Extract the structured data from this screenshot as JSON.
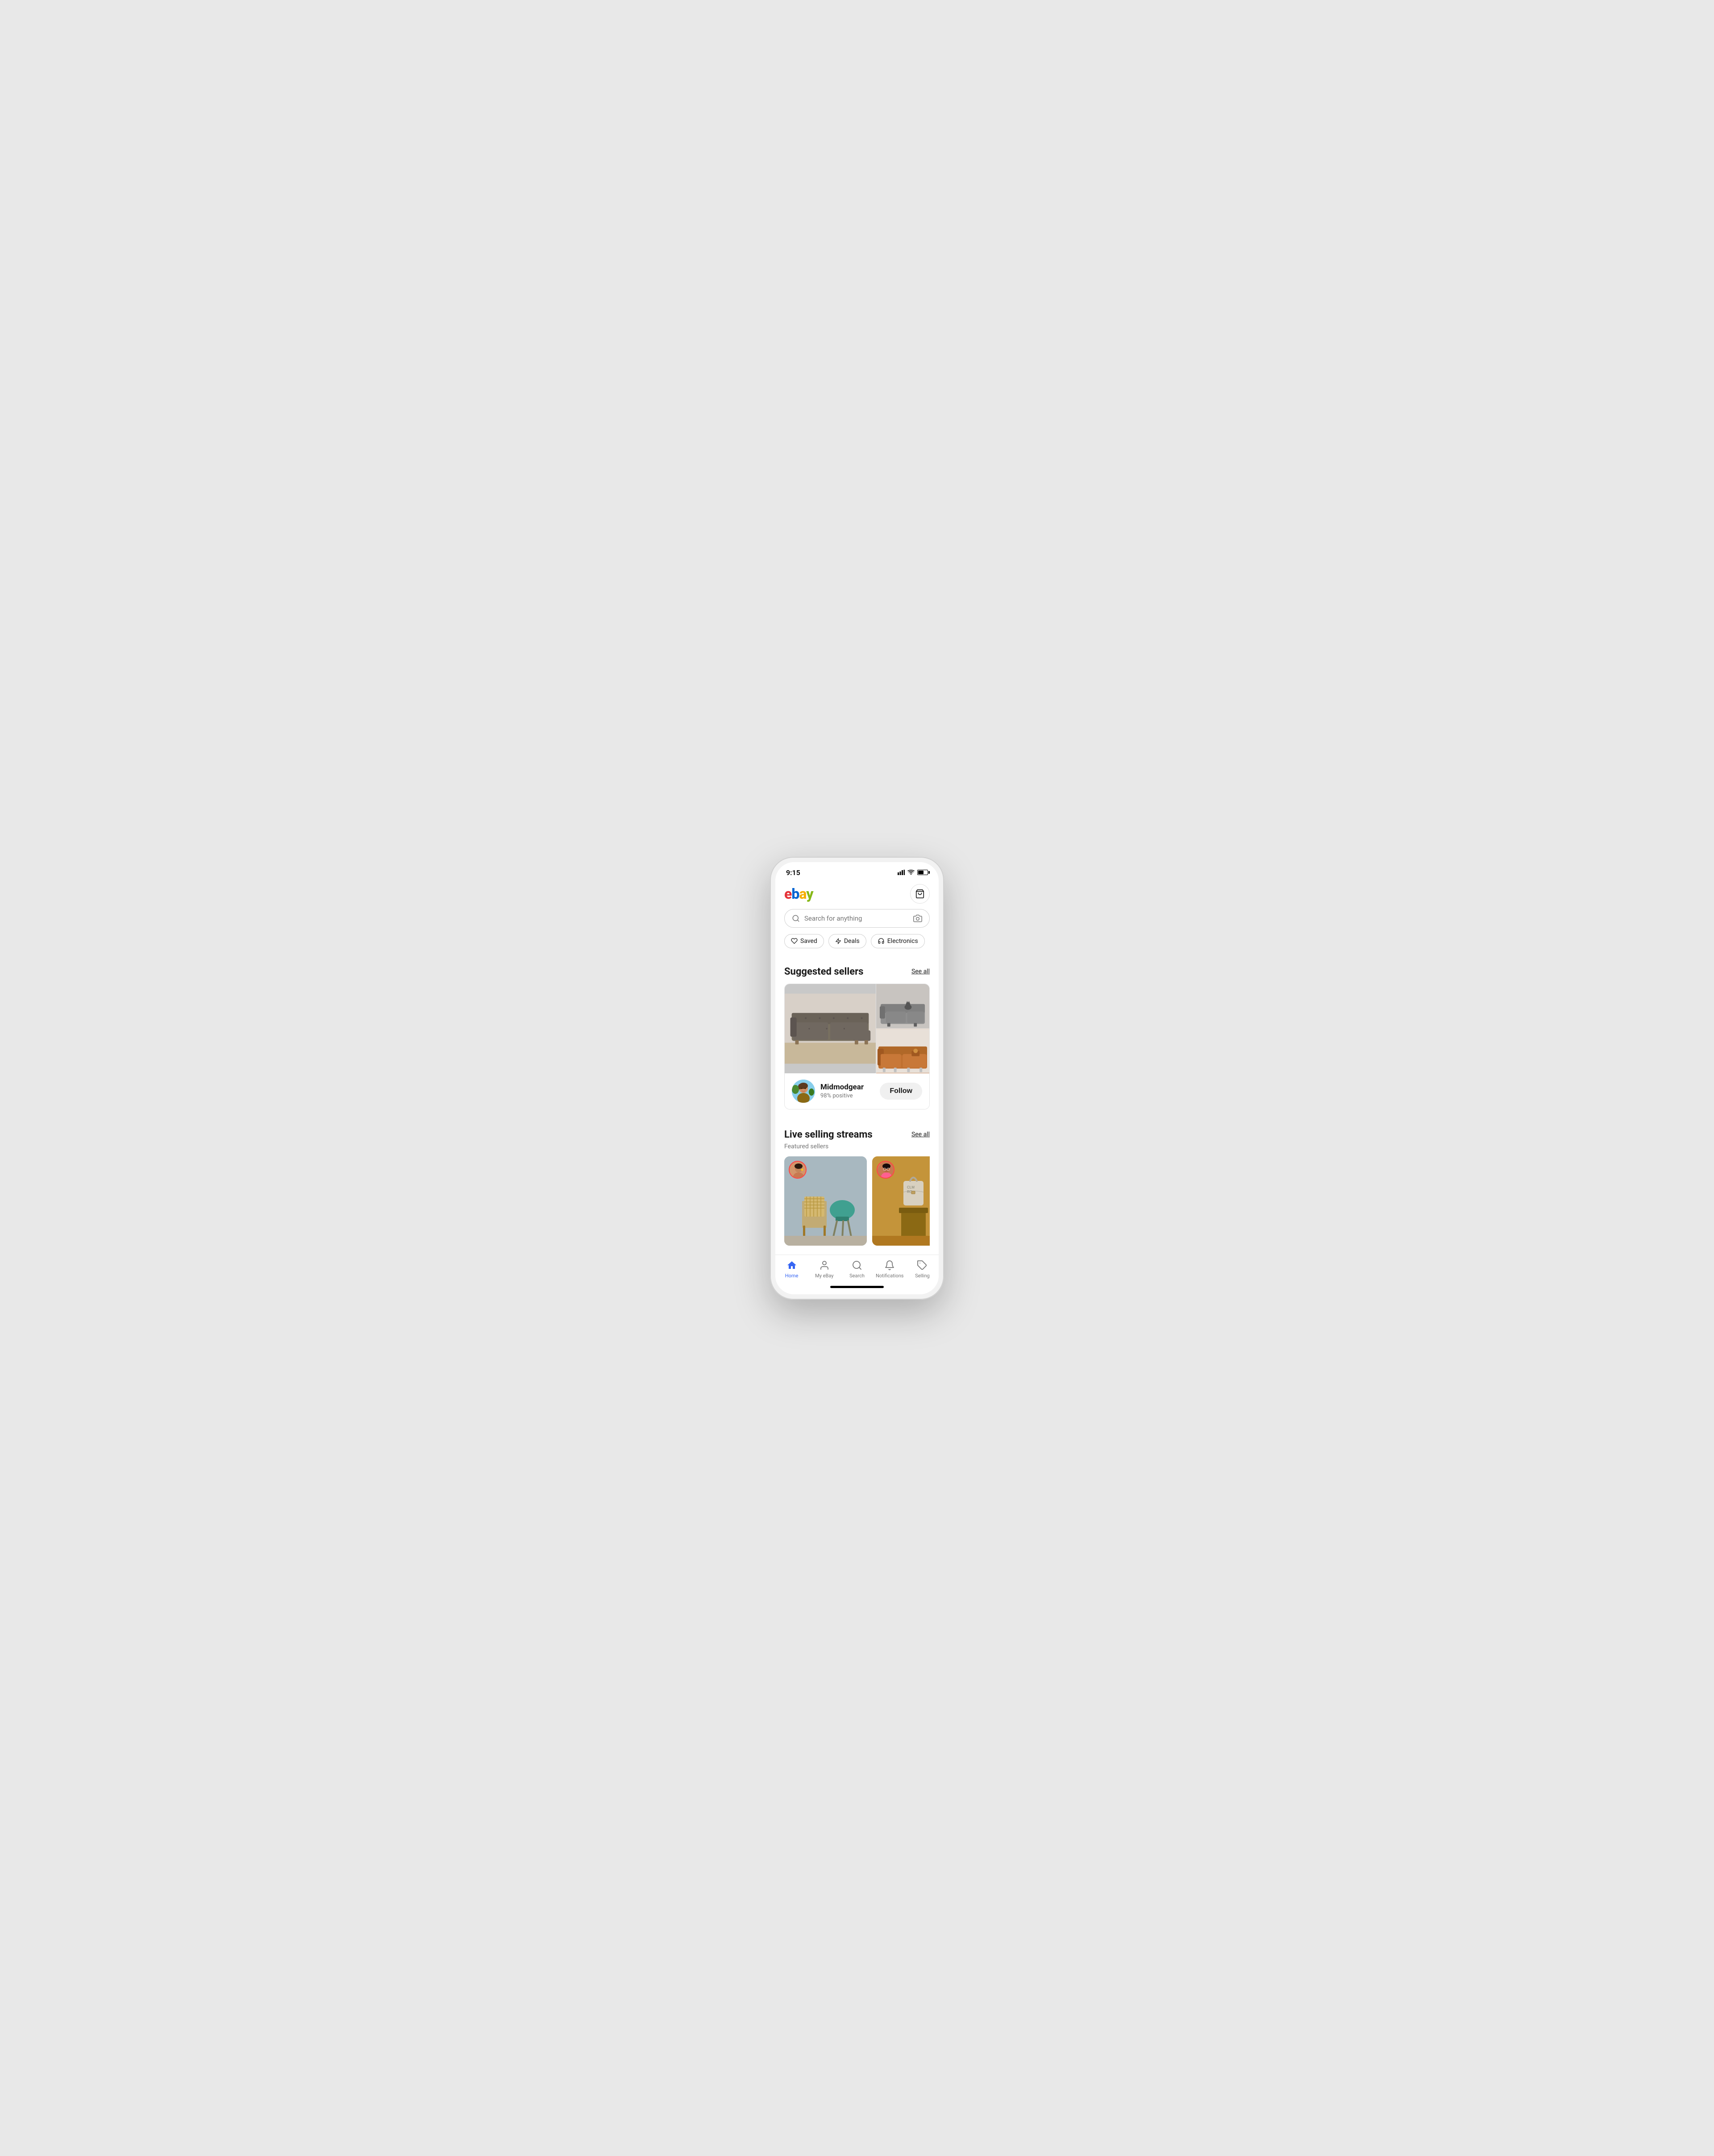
{
  "status": {
    "time": "9:15"
  },
  "header": {
    "logo": "ebay",
    "logo_letters": [
      "e",
      "b",
      "a",
      "y"
    ],
    "cart_label": "cart"
  },
  "search": {
    "placeholder": "Search for anything"
  },
  "filters": [
    {
      "id": "saved",
      "label": "Saved",
      "icon": "heart"
    },
    {
      "id": "deals",
      "label": "Deals",
      "icon": "lightning"
    },
    {
      "id": "electronics",
      "label": "Electronics",
      "icon": "headphones"
    }
  ],
  "suggested_sellers": {
    "title": "Suggested sellers",
    "see_all": "See all",
    "seller": {
      "name": "Midmodgear",
      "rating": "98% positive",
      "follow_label": "Follow"
    }
  },
  "live_streams": {
    "title": "Live selling streams",
    "subtitle": "Featured sellers",
    "see_all": "See all"
  },
  "bottom_nav": {
    "items": [
      {
        "id": "home",
        "label": "Home",
        "active": true
      },
      {
        "id": "my-ebay",
        "label": "My eBay",
        "active": false
      },
      {
        "id": "search",
        "label": "Search",
        "active": false
      },
      {
        "id": "notifications",
        "label": "Notifications",
        "active": false
      },
      {
        "id": "selling",
        "label": "Selling",
        "active": false
      }
    ]
  }
}
